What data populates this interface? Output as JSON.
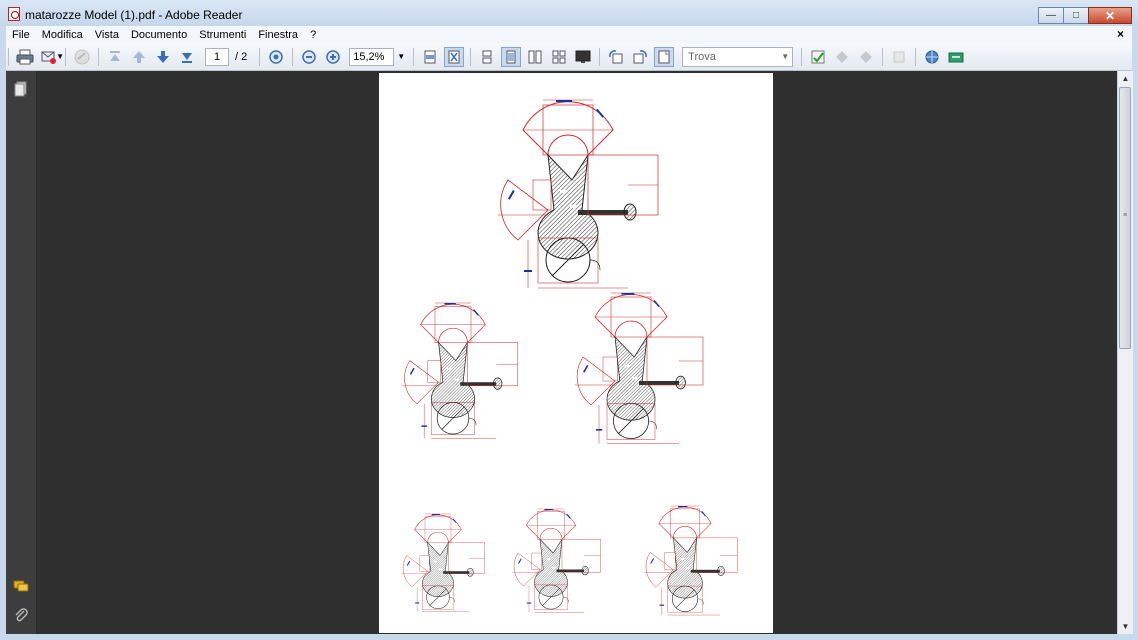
{
  "window": {
    "title": "matarozze Model (1).pdf - Adobe Reader"
  },
  "menu": [
    "File",
    "Modifica",
    "Vista",
    "Documento",
    "Strumenti",
    "Finestra",
    "?"
  ],
  "toolbar": {
    "page_current": "1",
    "page_total": "/ 2",
    "zoom": "15,2%",
    "find_placeholder": "Trova"
  },
  "colors": {
    "drawing_red": "#cc2a2a",
    "drawing_blue": "#1a2fb0",
    "doc_bg": "#2f2f2f",
    "panel_bg": "#3d3d3d"
  },
  "icons": [
    "print-icon",
    "email-icon",
    "sign-icon",
    "first-page-icon",
    "prev-page-icon",
    "next-page-icon",
    "last-page-icon",
    "actual-size-icon",
    "zoom-out-icon",
    "zoom-in-icon",
    "fit-page-icon",
    "fit-width-icon",
    "single-page-icon",
    "continuous-icon",
    "two-page-icon",
    "two-continuous-icon",
    "full-screen-icon",
    "rotate-left-icon",
    "rotate-right-icon",
    "reading-mode-icon",
    "spell-icon",
    "comment-icon",
    "highlight-icon",
    "attach-icon",
    "web-icon",
    "tools-icon"
  ]
}
